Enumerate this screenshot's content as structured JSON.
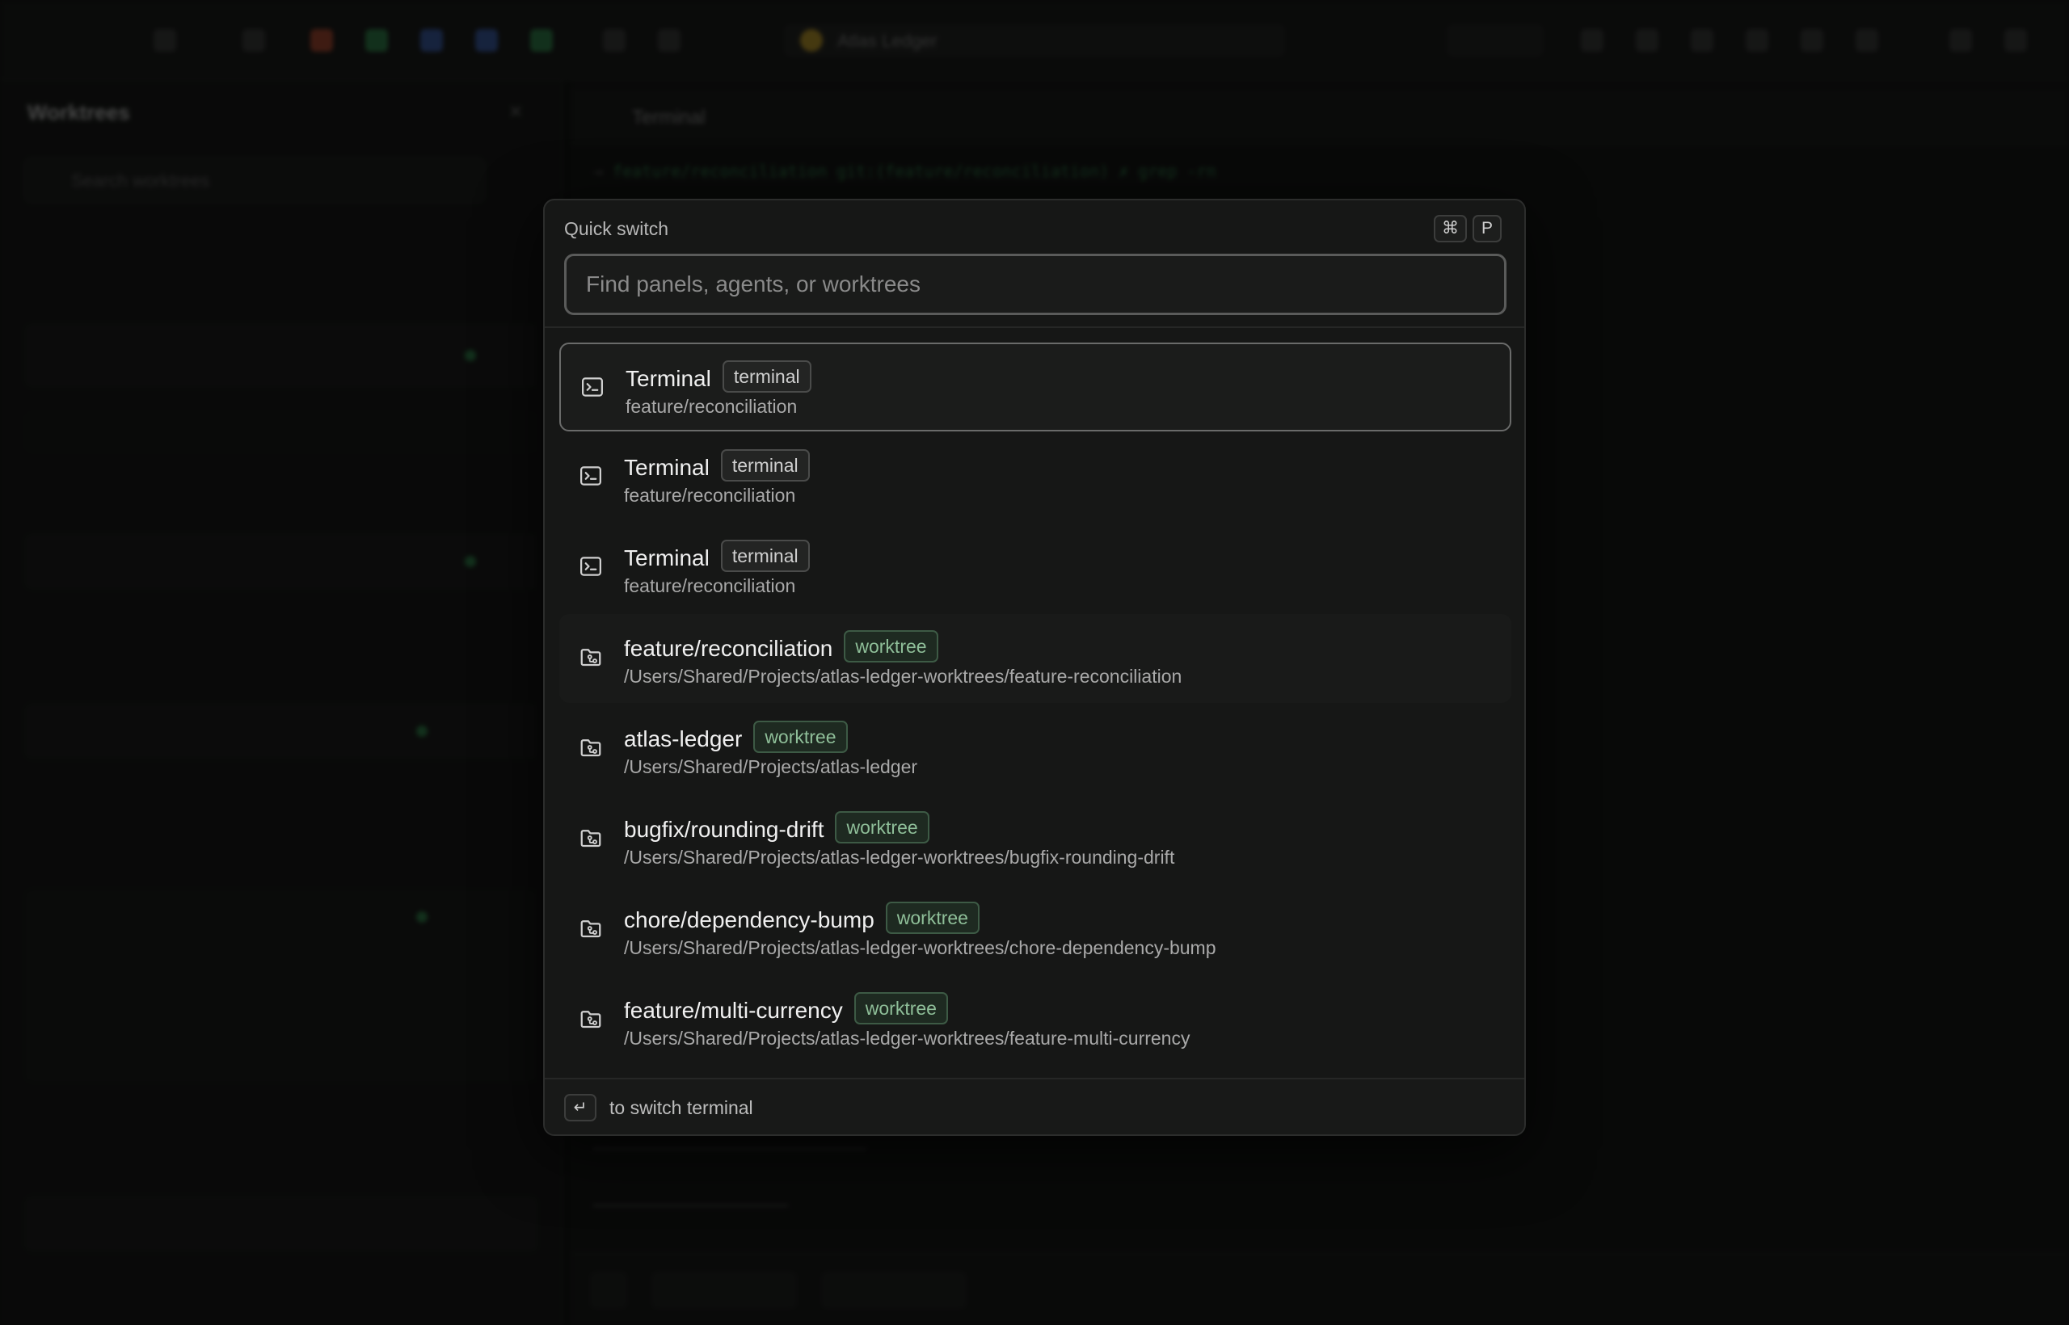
{
  "quick_switch": {
    "title": "Quick switch",
    "shortcut_keys": [
      "⌘",
      "P"
    ],
    "search_placeholder": "Find panels, agents, or worktrees",
    "items": [
      {
        "name": "Terminal",
        "badge": "terminal",
        "sub": "feature/reconciliation",
        "icon": "terminal-icon"
      },
      {
        "name": "Terminal",
        "badge": "terminal",
        "sub": "feature/reconciliation",
        "icon": "terminal-icon"
      },
      {
        "name": "Terminal",
        "badge": "terminal",
        "sub": "feature/reconciliation",
        "icon": "terminal-icon"
      },
      {
        "name": "feature/reconciliation",
        "badge": "worktree",
        "sub": "/Users/Shared/Projects/atlas-ledger-worktrees/feature-reconciliation",
        "icon": "folder-git-icon"
      },
      {
        "name": "atlas-ledger",
        "badge": "worktree",
        "sub": "/Users/Shared/Projects/atlas-ledger",
        "icon": "folder-git-icon"
      },
      {
        "name": "bugfix/rounding-drift",
        "badge": "worktree",
        "sub": "/Users/Shared/Projects/atlas-ledger-worktrees/bugfix-rounding-drift",
        "icon": "folder-git-icon"
      },
      {
        "name": "chore/dependency-bump",
        "badge": "worktree",
        "sub": "/Users/Shared/Projects/atlas-ledger-worktrees/chore-dependency-bump",
        "icon": "folder-git-icon"
      },
      {
        "name": "feature/multi-currency",
        "badge": "worktree",
        "sub": "/Users/Shared/Projects/atlas-ledger-worktrees/feature-multi-currency",
        "icon": "folder-git-icon"
      }
    ],
    "footer": {
      "enter_key": "↵",
      "hint": "to switch terminal"
    }
  },
  "background": {
    "topbar_title": "Atlas Ledger",
    "sidebar_title": "Worktrees",
    "sidebar_search_placeholder": "Search worktrees",
    "panel_title": "Terminal",
    "terminal_prompt": "feature/reconciliation git:(feature/reconciliation) ✗ grep -rn"
  },
  "colors": {
    "accent_green": "#2f8a4c",
    "modal_bg": "#161716",
    "worktree_badge": "#8fbf99"
  }
}
